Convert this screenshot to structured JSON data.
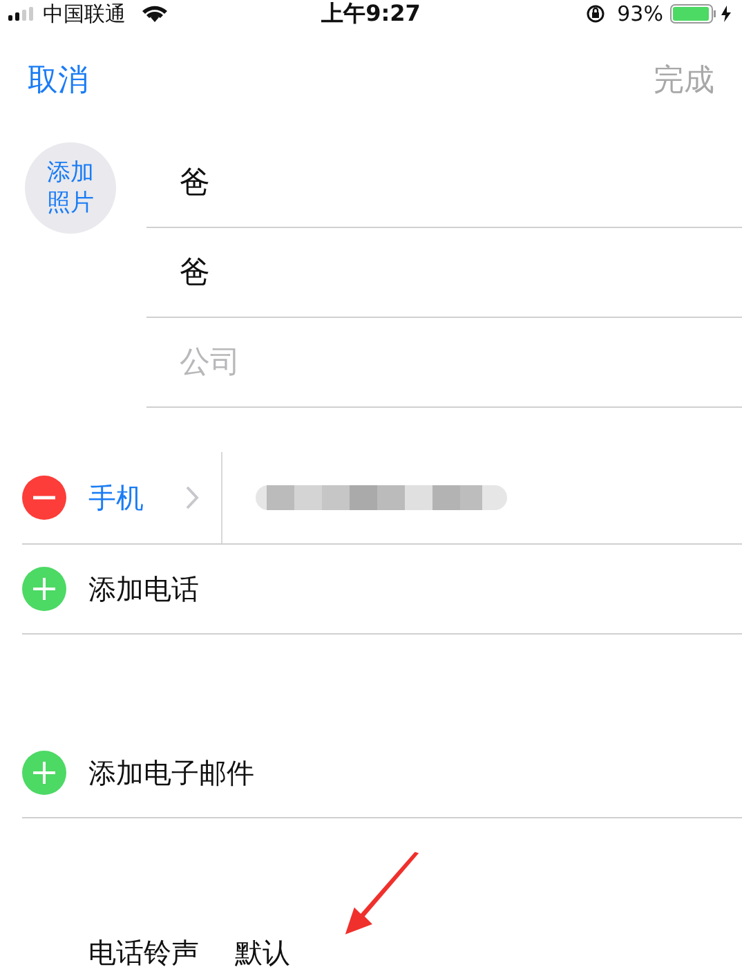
{
  "status_bar": {
    "carrier": "中国联通",
    "time": "上午9:27",
    "battery": "93%"
  },
  "nav": {
    "cancel": "取消",
    "done": {
      "label": "完成",
      "disabled": true
    }
  },
  "photo": {
    "label": "添加照片"
  },
  "name_fields": [
    {
      "value": "爸"
    },
    {
      "value": "爸"
    },
    {
      "placeholder": "公司"
    }
  ],
  "phone": {
    "label": "手机"
  },
  "add_rows": [
    {
      "label": "添加电话",
      "kind": "add"
    },
    {
      "label": "添加电子邮件",
      "kind": "add"
    }
  ],
  "ringtone": {
    "label": "电话铃声",
    "value": "默认"
  }
}
